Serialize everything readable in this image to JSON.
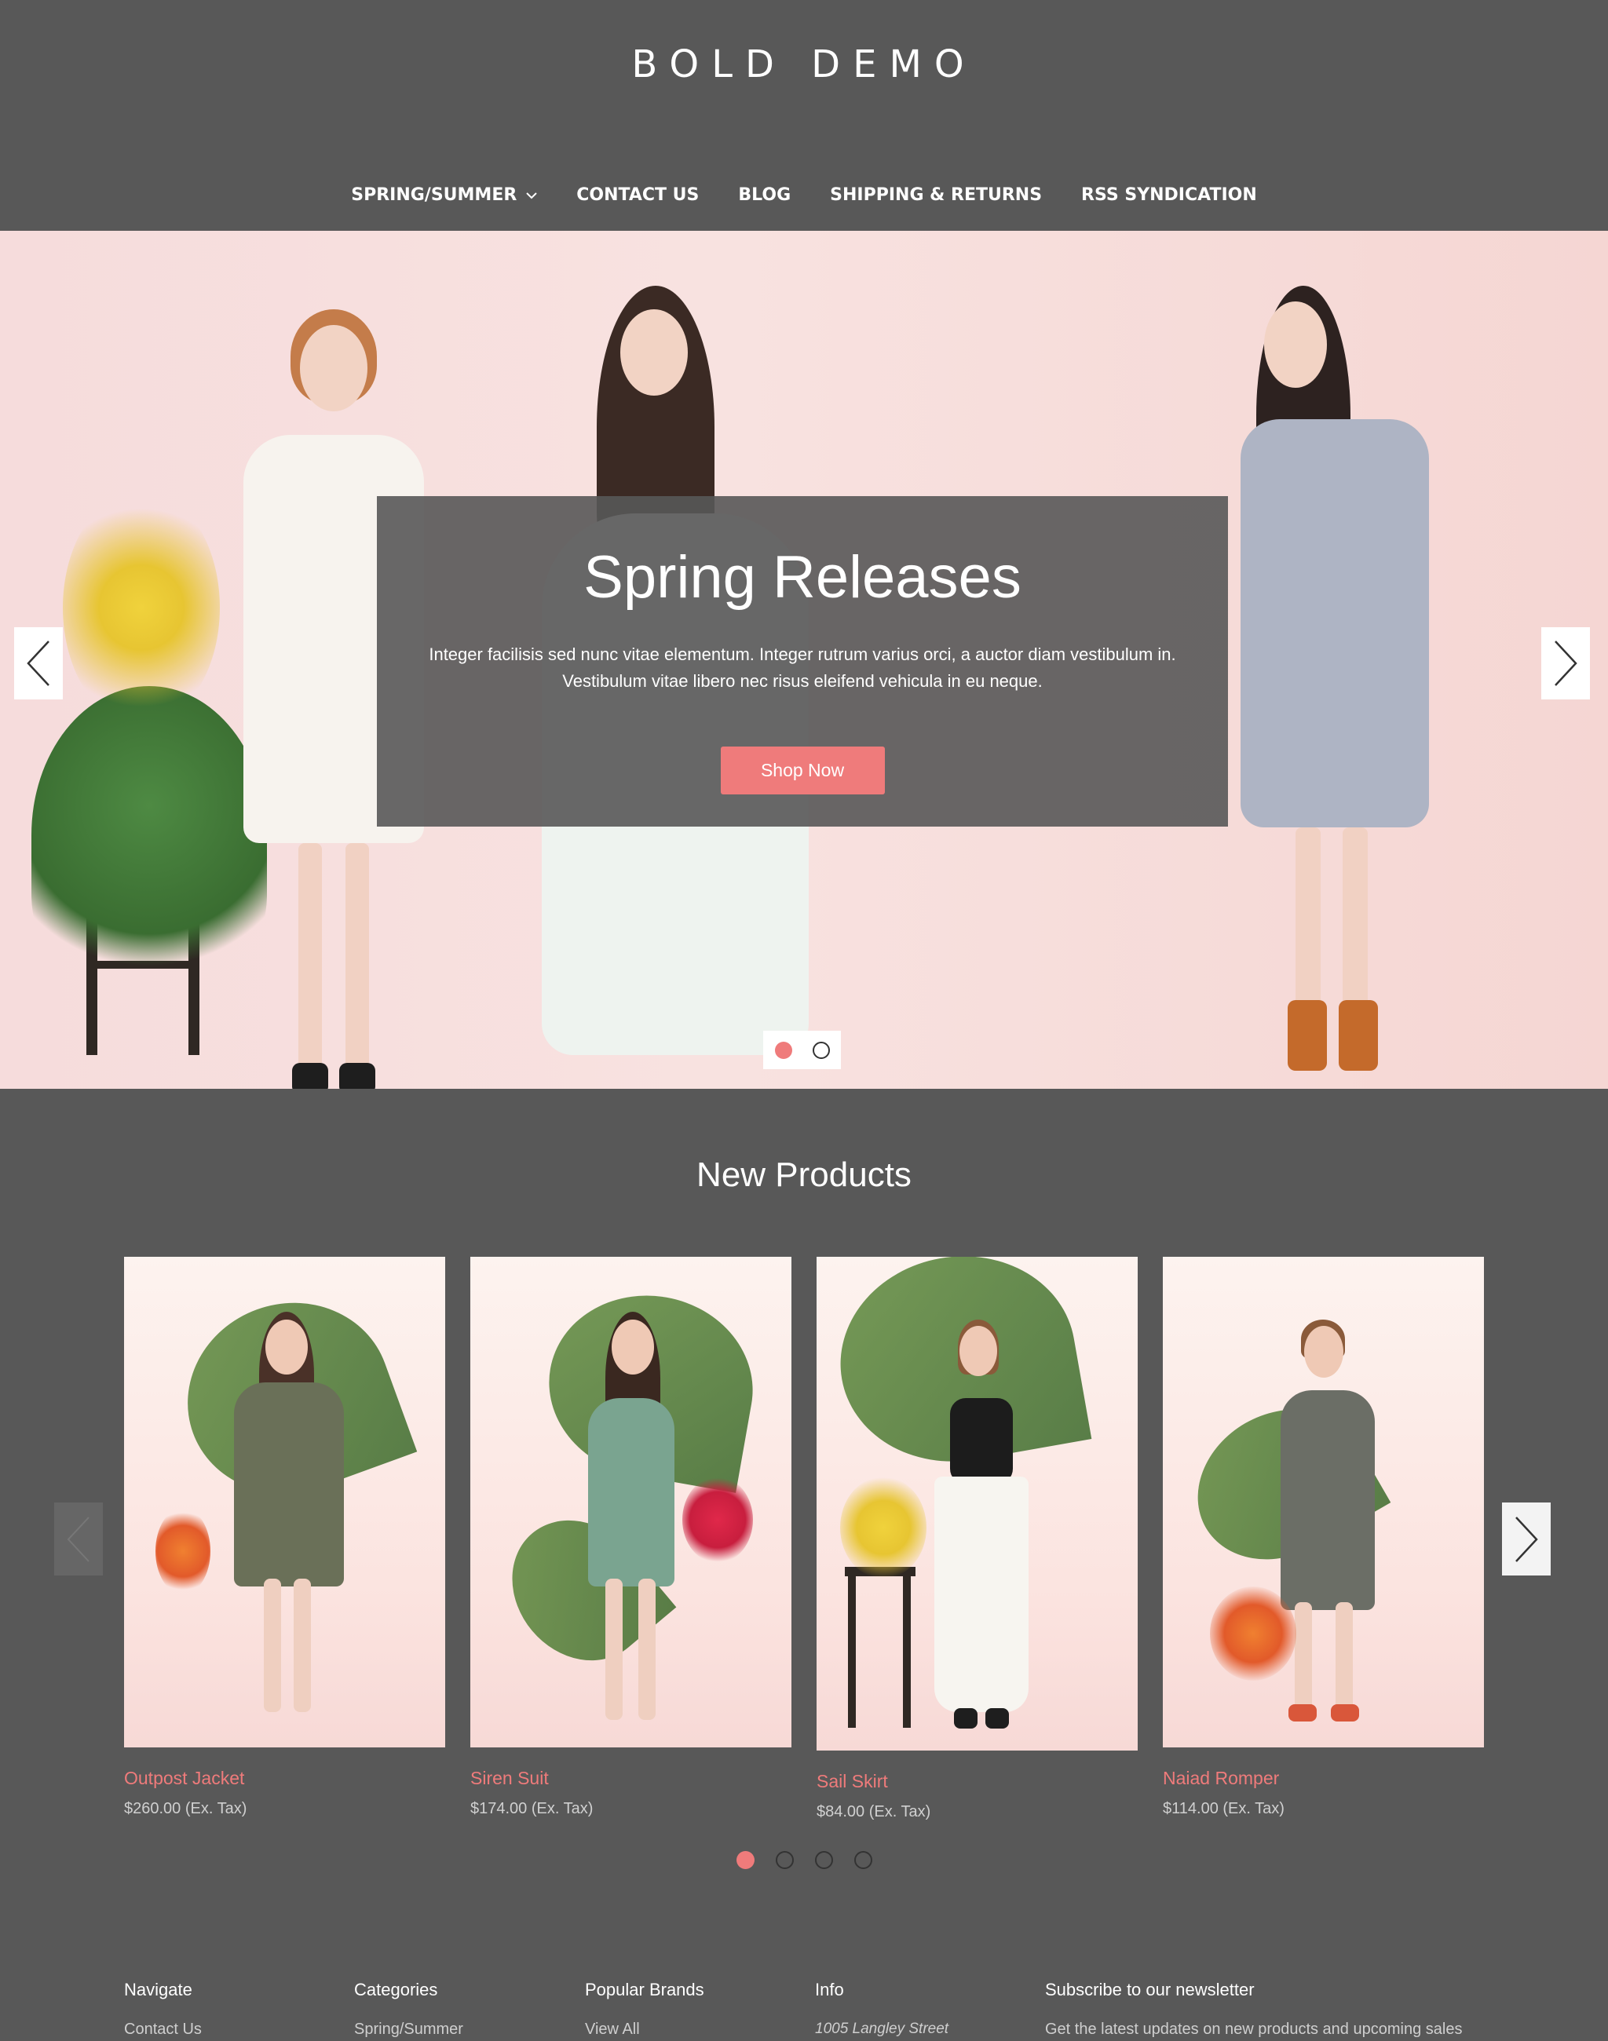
{
  "header": {
    "logo": "BOLD DEMO",
    "nav": [
      {
        "label": "SPRING/SUMMER",
        "has_dropdown": true
      },
      {
        "label": "CONTACT US"
      },
      {
        "label": "BLOG"
      },
      {
        "label": "SHIPPING & RETURNS"
      },
      {
        "label": "RSS SYNDICATION"
      }
    ]
  },
  "hero": {
    "title": "Spring Releases",
    "text": "Integer facilisis sed nunc vitae elementum. Integer rutrum varius orci, a auctor diam vestibulum in. Vestibulum vitae libero nec risus eleifend vehicula in eu neque.",
    "button": "Shop Now",
    "slides_total": 2,
    "active_slide": 1
  },
  "products": {
    "title": "New Products",
    "items": [
      {
        "name": "Outpost Jacket",
        "price": "$260.00 (Ex. Tax)"
      },
      {
        "name": "Siren Suit",
        "price": "$174.00 (Ex. Tax)"
      },
      {
        "name": "Sail Skirt",
        "price": "$84.00 (Ex. Tax)"
      },
      {
        "name": "Naiad Romper",
        "price": "$114.00 (Ex. Tax)"
      }
    ],
    "pages_total": 4,
    "active_page": 1
  },
  "footer": {
    "navigate": {
      "heading": "Navigate",
      "first_link": "Contact Us"
    },
    "categories": {
      "heading": "Categories",
      "first_link": "Spring/Summer"
    },
    "brands": {
      "heading": "Popular Brands",
      "first_link": "View All"
    },
    "info": {
      "heading": "Info",
      "address": "1005 Langley Street"
    },
    "newsletter": {
      "heading": "Subscribe to our newsletter",
      "text": "Get the latest updates on new products and upcoming sales"
    }
  },
  "colors": {
    "background": "#585858",
    "accent": "#ef7b7b",
    "hero_overlay": "#585858"
  },
  "icons": [
    "chevron-down-icon",
    "chevron-left-icon",
    "chevron-right-icon"
  ]
}
